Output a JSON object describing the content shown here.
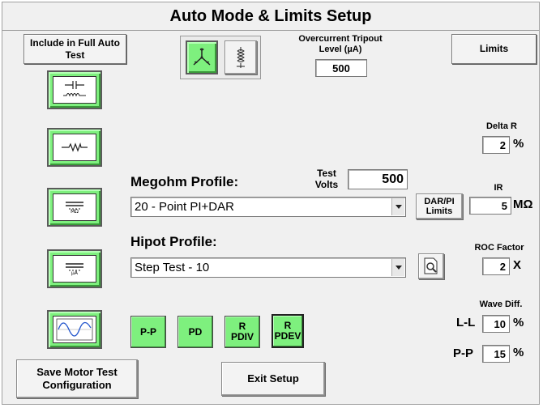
{
  "window": {
    "title": "Auto Mode & Limits Setup"
  },
  "include_label": "Include in Full Auto Test",
  "limits_label": "Limits",
  "test_tiles": [
    {
      "name": "surge-test",
      "icon": "capacitor-coil-icon"
    },
    {
      "name": "resistance-test",
      "icon": "resistor-icon",
      "delta_r": {
        "label": "Delta R",
        "value": "2",
        "unit": "%"
      }
    },
    {
      "name": "megohm-test",
      "icon": "megohm-icon",
      "icon_text": "MΩ"
    },
    {
      "name": "hipot-test",
      "icon": "hipot-icon",
      "icon_text": "µA"
    },
    {
      "name": "waveform-test",
      "icon": "sine-wave-icon"
    }
  ],
  "config_toggle": {
    "wye": "wye-connection-icon",
    "coil": "single-coil-icon"
  },
  "overcurrent": {
    "label": "Overcurrent Tripout Level (µA)",
    "value": "500"
  },
  "megohm": {
    "label": "Megohm Profile:",
    "test_volts_label": "Test Volts",
    "test_volts_value": "500",
    "selected": "20 - Point PI+DAR",
    "dar_pi_button": "DAR/PI Limits",
    "ir_label": "IR",
    "ir_value": "5",
    "ir_unit": "MΩ"
  },
  "hipot": {
    "label": "Hipot Profile:",
    "selected": "Step Test - 10",
    "roc_label": "ROC Factor",
    "roc_value": "2",
    "roc_unit": "X"
  },
  "wave_diff": {
    "label": "Wave Diff.",
    "ll_label": "L-L",
    "ll_value": "10",
    "ll_unit": "%",
    "pp_label": "P-P",
    "pp_value": "15",
    "pp_unit": "%"
  },
  "surge_buttons": [
    {
      "label": "P-P"
    },
    {
      "label": "PD"
    },
    {
      "label": "R PDIV"
    },
    {
      "label": "R PDEV"
    }
  ],
  "actions": {
    "save": "Save Motor Test Configuration",
    "exit": "Exit Setup"
  },
  "colors": {
    "active_green": "#7ef07e",
    "panel": "#f0f0f0"
  }
}
